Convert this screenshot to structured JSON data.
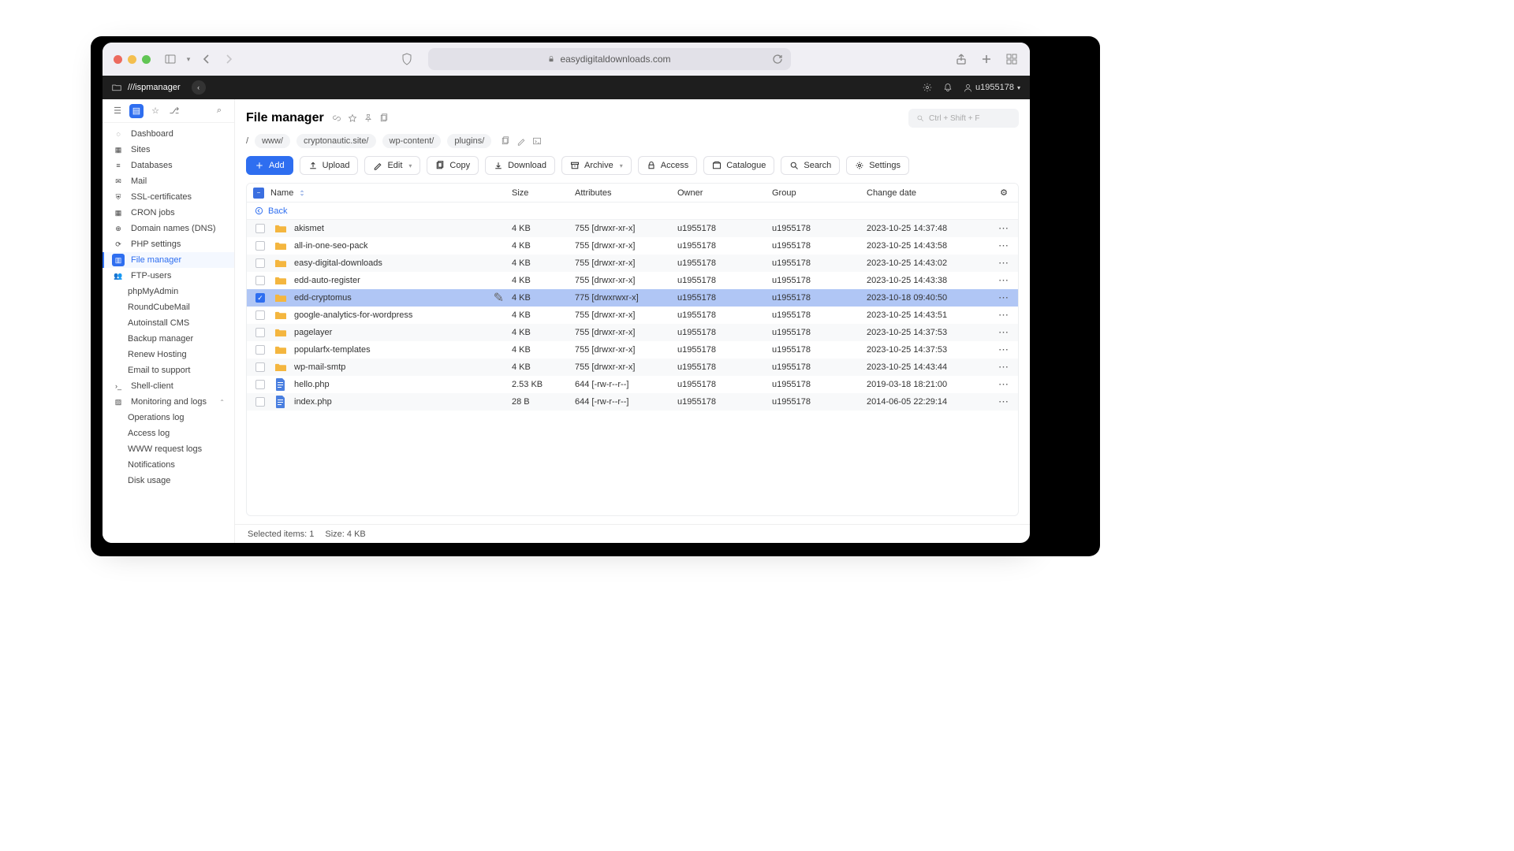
{
  "browser": {
    "url_text": "easydigitaldownloads.com"
  },
  "appbar": {
    "brand": "ispmanager",
    "user": "u1955178"
  },
  "sidebar": {
    "items": [
      {
        "label": "Dashboard",
        "type": "item"
      },
      {
        "label": "Sites",
        "type": "item"
      },
      {
        "label": "Databases",
        "type": "item"
      },
      {
        "label": "Mail",
        "type": "item"
      },
      {
        "label": "SSL-certificates",
        "type": "item"
      },
      {
        "label": "CRON jobs",
        "type": "item"
      },
      {
        "label": "Domain names (DNS)",
        "type": "item"
      },
      {
        "label": "PHP settings",
        "type": "item"
      },
      {
        "label": "File manager",
        "type": "item",
        "active": true
      },
      {
        "label": "FTP-users",
        "type": "item"
      },
      {
        "label": "phpMyAdmin",
        "type": "sub"
      },
      {
        "label": "RoundCubeMail",
        "type": "sub"
      },
      {
        "label": "Autoinstall CMS",
        "type": "sub"
      },
      {
        "label": "Backup manager",
        "type": "sub"
      },
      {
        "label": "Renew Hosting",
        "type": "sub"
      },
      {
        "label": "Email to support",
        "type": "sub"
      },
      {
        "label": "Shell-client",
        "type": "item"
      },
      {
        "label": "Monitoring and logs",
        "type": "item",
        "chev": true
      },
      {
        "label": "Operations log",
        "type": "sub"
      },
      {
        "label": "Access log",
        "type": "sub"
      },
      {
        "label": "WWW request logs",
        "type": "sub"
      },
      {
        "label": "Notifications",
        "type": "sub"
      },
      {
        "label": "Disk usage",
        "type": "sub"
      }
    ]
  },
  "page": {
    "title": "File manager",
    "search_placeholder": "Ctrl + Shift + F",
    "breadcrumbs": [
      "/",
      "www/",
      "cryptonautic.site/",
      "wp-content/",
      "plugins/"
    ],
    "toolbar": [
      {
        "label": "Add",
        "primary": true,
        "icon": "plus"
      },
      {
        "label": "Upload",
        "icon": "upload"
      },
      {
        "label": "Edit",
        "icon": "pencil",
        "caret": true
      },
      {
        "label": "Copy",
        "icon": "copy"
      },
      {
        "label": "Download",
        "icon": "download"
      },
      {
        "label": "Archive",
        "icon": "archive",
        "caret": true
      },
      {
        "label": "Access",
        "icon": "lock"
      },
      {
        "label": "Catalogue",
        "icon": "catalog"
      },
      {
        "label": "Search",
        "icon": "search"
      },
      {
        "label": "Settings",
        "icon": "gear"
      }
    ],
    "columns": [
      "Name",
      "Size",
      "Attributes",
      "Owner",
      "Group",
      "Change date"
    ],
    "back_label": "Back",
    "rows": [
      {
        "name": "akismet",
        "kind": "folder",
        "size": "4 KB",
        "attr": "755 [drwxr-xr-x]",
        "owner": "u1955178",
        "group": "u1955178",
        "date": "2023-10-25 14:37:48"
      },
      {
        "name": "all-in-one-seo-pack",
        "kind": "folder",
        "size": "4 KB",
        "attr": "755 [drwxr-xr-x]",
        "owner": "u1955178",
        "group": "u1955178",
        "date": "2023-10-25 14:43:58"
      },
      {
        "name": "easy-digital-downloads",
        "kind": "folder",
        "size": "4 KB",
        "attr": "755 [drwxr-xr-x]",
        "owner": "u1955178",
        "group": "u1955178",
        "date": "2023-10-25 14:43:02"
      },
      {
        "name": "edd-auto-register",
        "kind": "folder",
        "size": "4 KB",
        "attr": "755 [drwxr-xr-x]",
        "owner": "u1955178",
        "group": "u1955178",
        "date": "2023-10-25 14:43:38"
      },
      {
        "name": "edd-cryptomus",
        "kind": "folder",
        "size": "4 KB",
        "attr": "775 [drwxrwxr-x]",
        "owner": "u1955178",
        "group": "u1955178",
        "date": "2023-10-18 09:40:50",
        "selected": true,
        "editable": true
      },
      {
        "name": "google-analytics-for-wordpress",
        "kind": "folder",
        "size": "4 KB",
        "attr": "755 [drwxr-xr-x]",
        "owner": "u1955178",
        "group": "u1955178",
        "date": "2023-10-25 14:43:51"
      },
      {
        "name": "pagelayer",
        "kind": "folder",
        "size": "4 KB",
        "attr": "755 [drwxr-xr-x]",
        "owner": "u1955178",
        "group": "u1955178",
        "date": "2023-10-25 14:37:53"
      },
      {
        "name": "popularfx-templates",
        "kind": "folder",
        "size": "4 KB",
        "attr": "755 [drwxr-xr-x]",
        "owner": "u1955178",
        "group": "u1955178",
        "date": "2023-10-25 14:37:53"
      },
      {
        "name": "wp-mail-smtp",
        "kind": "folder",
        "size": "4 KB",
        "attr": "755 [drwxr-xr-x]",
        "owner": "u1955178",
        "group": "u1955178",
        "date": "2023-10-25 14:43:44"
      },
      {
        "name": "hello.php",
        "kind": "file",
        "size": "2.53 KB",
        "attr": "644 [-rw-r--r--]",
        "owner": "u1955178",
        "group": "u1955178",
        "date": "2019-03-18 18:21:00"
      },
      {
        "name": "index.php",
        "kind": "file",
        "size": "28 B",
        "attr": "644 [-rw-r--r--]",
        "owner": "u1955178",
        "group": "u1955178",
        "date": "2014-06-05 22:29:14"
      }
    ],
    "status": {
      "selected_label": "Selected items:",
      "selected_count": "1",
      "size_label": "Size:",
      "size_value": "4 KB"
    }
  }
}
